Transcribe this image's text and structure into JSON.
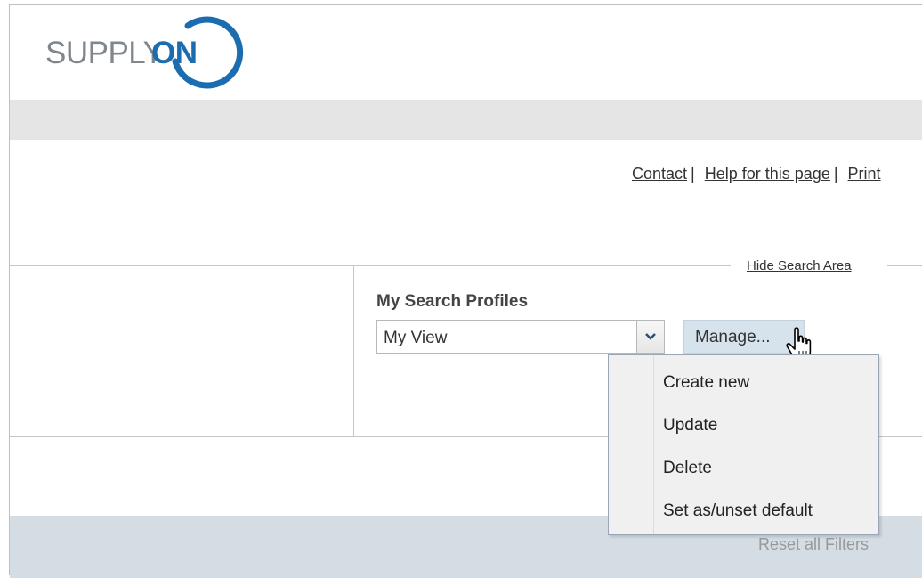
{
  "logo": {
    "part1": "SUPPLY",
    "part2": "ON"
  },
  "top_links": {
    "contact": "Contact",
    "help": "Help for this page",
    "print": "Print"
  },
  "search_area": {
    "hide_label": "Hide Search Area",
    "profiles_label": "My Search Profiles",
    "selected_profile": "My View",
    "manage_label": "Manage..."
  },
  "manage_menu": {
    "items": [
      {
        "label": "Create new"
      },
      {
        "label": "Update"
      },
      {
        "label": "Delete"
      },
      {
        "label": "Set as/unset default"
      }
    ]
  },
  "results_bar": {
    "reset_label": "Reset all Filters"
  },
  "colors": {
    "brand_blue": "#1c6daf",
    "logo_grey": "#7f868c",
    "band_grey": "#e5e5e5",
    "results_bar": "#d4dde4"
  }
}
